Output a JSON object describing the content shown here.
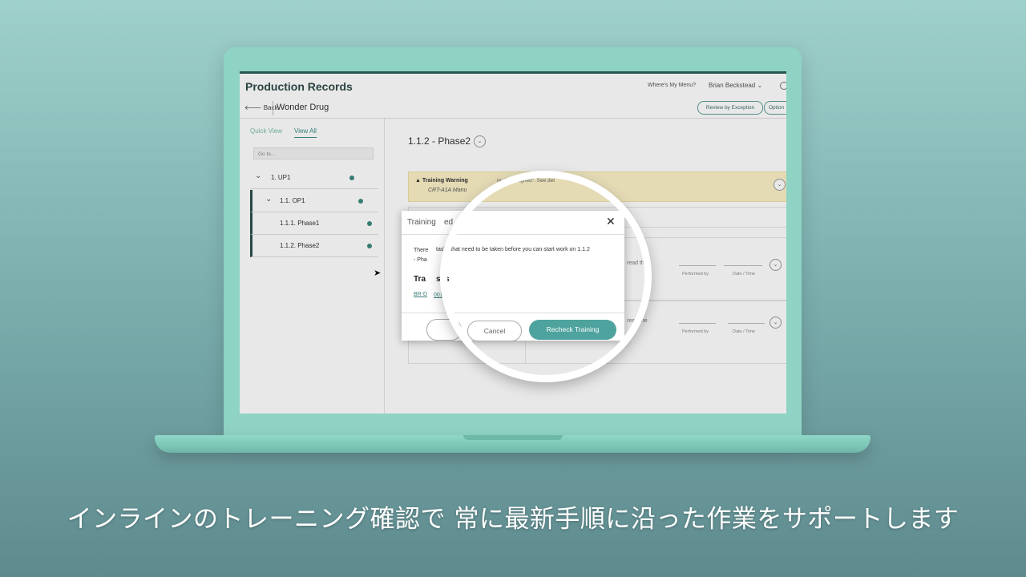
{
  "app": {
    "title": "Production Records",
    "menu_link": "Where's My Menu?",
    "user": "Brian Beckstead"
  },
  "subbar": {
    "back": "Back",
    "record": "Wonder Drug",
    "review_btn": "Review by Exception",
    "options_btn": "Option"
  },
  "sidebar": {
    "tabs": [
      "Quick View",
      "View All"
    ],
    "goto_placeholder": "Go to...",
    "items": [
      {
        "label": "1.  UP1",
        "level": 0
      },
      {
        "label": "1.1.  OP1",
        "level": 1
      },
      {
        "label": "1.1.1.  Phase1",
        "level": 2
      },
      {
        "label": "1.1.2.  Phase2",
        "level": 2
      }
    ]
  },
  "main": {
    "phase_title": "1.1.2 - Phase2",
    "warning_title": "Training Warning",
    "warning_right": "re. Unassigned\". See det",
    "warning_sub": "CRT-A1A Manu",
    "steps": [
      {
        "text": "read the",
        "performed_by": "Performed by",
        "date_time": "Date / Time"
      },
      {
        "text": "read the",
        "performed_by": "Performed by",
        "date_time": "Date / Time"
      }
    ]
  },
  "dialog": {
    "title_a": "Training",
    "title_b": "ed",
    "msg_a": "There",
    "msg_b": "tasks that need to be taken before you can start work on 1.1.2",
    "msg_c": "- Pha",
    "tasks_a": "Tra",
    "tasks_b": "sks",
    "link_a": "BR-D",
    "link_b": "001",
    "cancel": "Cancel",
    "recheck": "Recheck Training"
  },
  "caption": "インラインのトレーニング確認で 常に最新手順に沿った作業をサポートします",
  "colors": {
    "background": "#8fc4c0",
    "laptop": "#8ed3c4",
    "accent": "#4fa39e"
  }
}
